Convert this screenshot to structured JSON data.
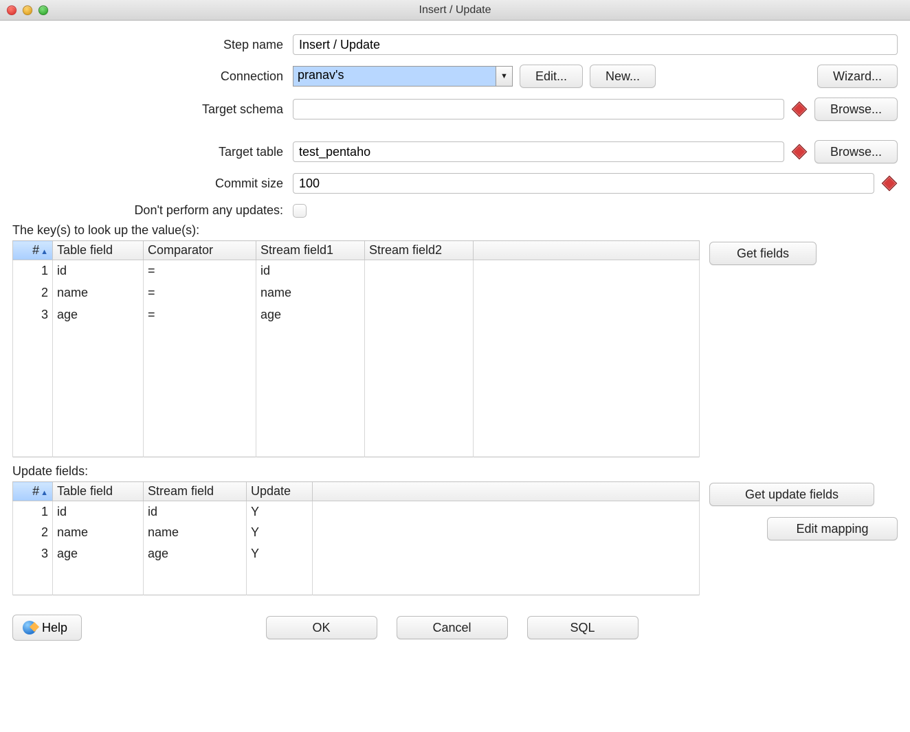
{
  "window": {
    "title": "Insert / Update"
  },
  "labels": {
    "step_name": "Step name",
    "connection": "Connection",
    "target_schema": "Target schema",
    "target_table": "Target table",
    "commit_size": "Commit size",
    "no_updates": "Don't perform any updates:",
    "keys_section": "The key(s) to look up the value(s):",
    "update_section": "Update fields:"
  },
  "fields": {
    "step_name": "Insert / Update",
    "connection": "pranav's",
    "target_schema": "",
    "target_table": "test_pentaho",
    "commit_size": "100"
  },
  "buttons": {
    "edit": "Edit...",
    "new": "New...",
    "wizard": "Wizard...",
    "browse": "Browse...",
    "get_fields": "Get fields",
    "get_update_fields": "Get update fields",
    "edit_mapping": "Edit mapping",
    "help": "Help",
    "ok": "OK",
    "cancel": "Cancel",
    "sql": "SQL"
  },
  "keys_table": {
    "headers": {
      "num": "#",
      "table_field": "Table field",
      "comparator": "Comparator",
      "stream1": "Stream field1",
      "stream2": "Stream field2"
    },
    "rows": [
      {
        "n": "1",
        "table_field": "id",
        "comparator": "=",
        "stream1": "id",
        "stream2": ""
      },
      {
        "n": "2",
        "table_field": "name",
        "comparator": "=",
        "stream1": "name",
        "stream2": ""
      },
      {
        "n": "3",
        "table_field": "age",
        "comparator": "=",
        "stream1": "age",
        "stream2": ""
      }
    ]
  },
  "update_table": {
    "headers": {
      "num": "#",
      "table_field": "Table field",
      "stream_field": "Stream field",
      "update": "Update"
    },
    "rows": [
      {
        "n": "1",
        "table_field": "id",
        "stream_field": "id",
        "update": "Y"
      },
      {
        "n": "2",
        "table_field": "name",
        "stream_field": "name",
        "update": "Y"
      },
      {
        "n": "3",
        "table_field": "age",
        "stream_field": "age",
        "update": "Y"
      }
    ]
  }
}
